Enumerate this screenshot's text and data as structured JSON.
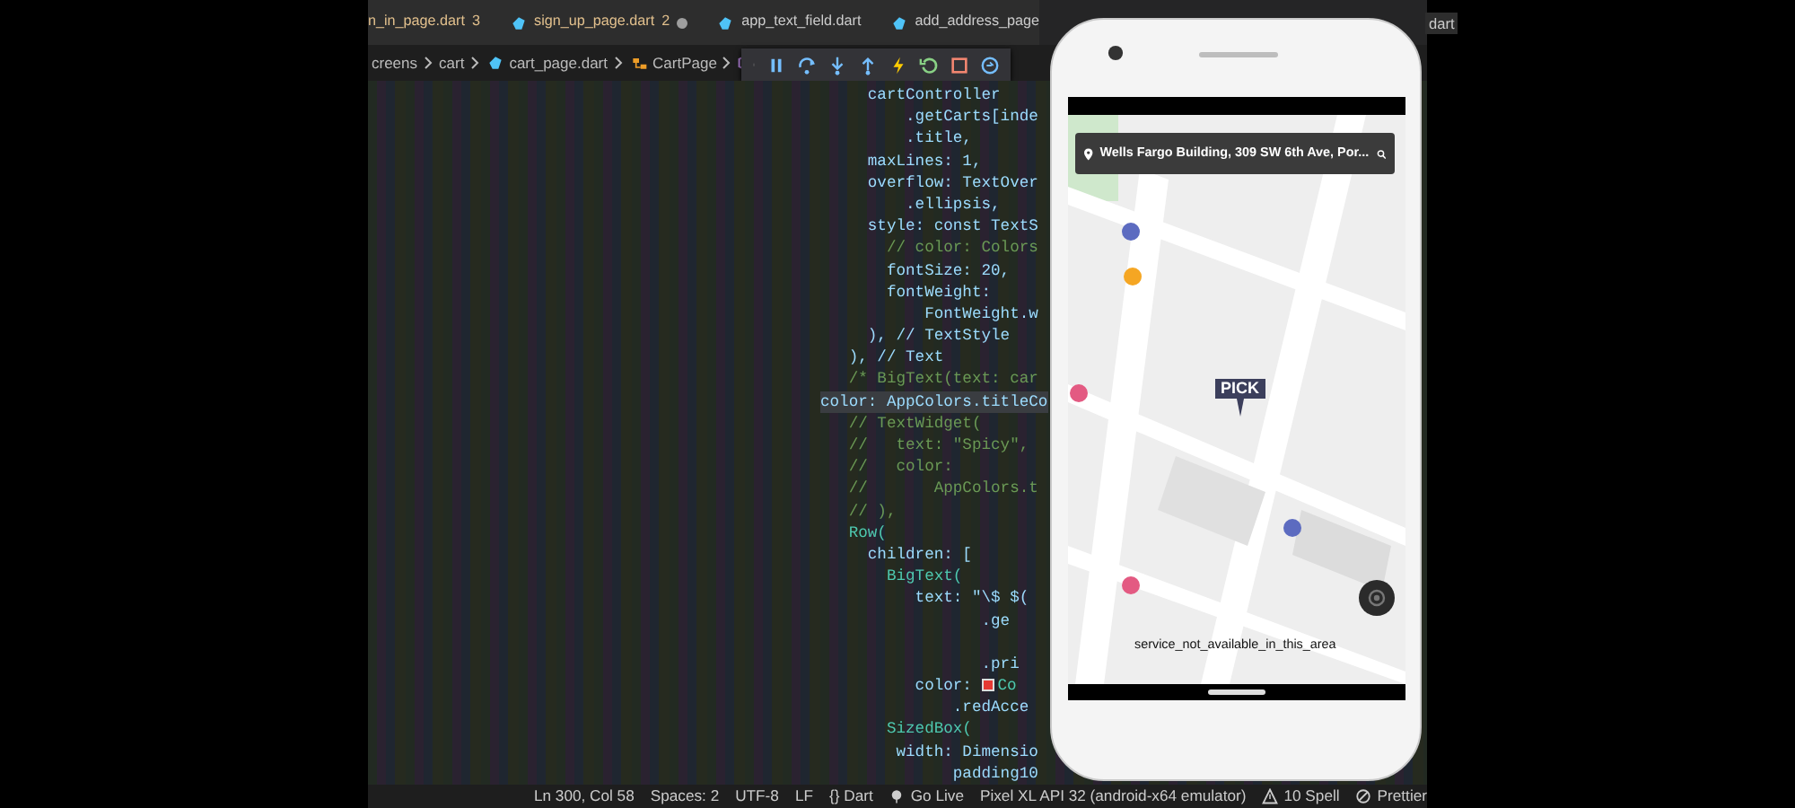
{
  "tabs": [
    {
      "label": "n_in_page.dart",
      "problems": "3",
      "dirty": false
    },
    {
      "label": "sign_up_page.dart",
      "problems": "2",
      "dirty": true
    },
    {
      "label": "app_text_field.dart",
      "dirty": false
    },
    {
      "label": "add_address_page",
      "dirty": false
    }
  ],
  "hidden_tab": {
    "label": "dart"
  },
  "breadcrumb": [
    {
      "kind": "folder",
      "label": "creens"
    },
    {
      "kind": "folder",
      "label": "cart"
    },
    {
      "kind": "file",
      "label": "cart_page.dart"
    },
    {
      "kind": "class",
      "label": "CartPage"
    },
    {
      "kind": "symbol"
    }
  ],
  "code_lines": [
    {
      "kind": "code",
      "text": "     cartController"
    },
    {
      "kind": "code",
      "text": "         .getCarts[inde"
    },
    {
      "kind": "code",
      "text": "         .title,"
    },
    {
      "kind": "code",
      "text": "     maxLines: 1,"
    },
    {
      "kind": "code",
      "text": "     overflow: TextOver"
    },
    {
      "kind": "code",
      "text": "         .ellipsis,"
    },
    {
      "kind": "code",
      "text": "     style: const TextS"
    },
    {
      "kind": "comment",
      "text": "       // color: Colors"
    },
    {
      "kind": "code",
      "text": "       fontSize: 20,"
    },
    {
      "kind": "code",
      "text": "       fontWeight:"
    },
    {
      "kind": "code",
      "text": "           FontWeight.w"
    },
    {
      "kind": "code",
      "text": "     ), // TextStyle"
    },
    {
      "kind": "code",
      "text": "   ), // Text"
    },
    {
      "kind": "comment",
      "text": "   /* BigText(text: car"
    },
    {
      "kind": "hover",
      "text": "color: AppColors.titleCo"
    },
    {
      "kind": "comment",
      "text": "   // TextWidget("
    },
    {
      "kind": "comment",
      "text": "   //   text: \"Spicy\","
    },
    {
      "kind": "comment",
      "text": "   //   color:"
    },
    {
      "kind": "comment",
      "text": "   //       AppColors.t"
    },
    {
      "kind": "comment",
      "text": "   // ),"
    },
    {
      "kind": "class",
      "text": "   Row("
    },
    {
      "kind": "code",
      "text": "     children: ["
    },
    {
      "kind": "class",
      "text": "       BigText("
    },
    {
      "kind": "code",
      "text": "          text: \"\\$ $("
    },
    {
      "kind": "code",
      "text": "                 .ge"
    },
    {
      "kind": "blank"
    },
    {
      "kind": "code",
      "text": "                 .pri"
    },
    {
      "kind": "code",
      "text": "          color: ",
      "color": "#e53935",
      "after": "Co"
    },
    {
      "kind": "code",
      "text": "              .redAcce"
    },
    {
      "kind": "class",
      "text": "       SizedBox("
    },
    {
      "kind": "code",
      "text": "        width: Dimensio"
    },
    {
      "kind": "code",
      "text": "              padding10"
    }
  ],
  "status_bar": [
    {
      "kind": "text",
      "label": "Ln 300, Col 58"
    },
    {
      "kind": "text",
      "label": "Spaces: 2"
    },
    {
      "kind": "text",
      "label": "UTF-8"
    },
    {
      "kind": "text",
      "label": "LF"
    },
    {
      "kind": "text",
      "label": "{} Dart"
    },
    {
      "kind": "live",
      "label": "Go Live"
    },
    {
      "kind": "text",
      "label": "Pixel XL API 32 (android-x64 emulator)"
    },
    {
      "kind": "warning",
      "label": "10 Spell"
    },
    {
      "kind": "blocked",
      "label": "Prettier"
    }
  ],
  "phone": {
    "search_bar": {
      "value": "Wells Fargo Building, 309 SW 6th Ave, Por..."
    },
    "marker": {
      "label": "PICK"
    },
    "toast": "service_not_available_in_this_area"
  }
}
